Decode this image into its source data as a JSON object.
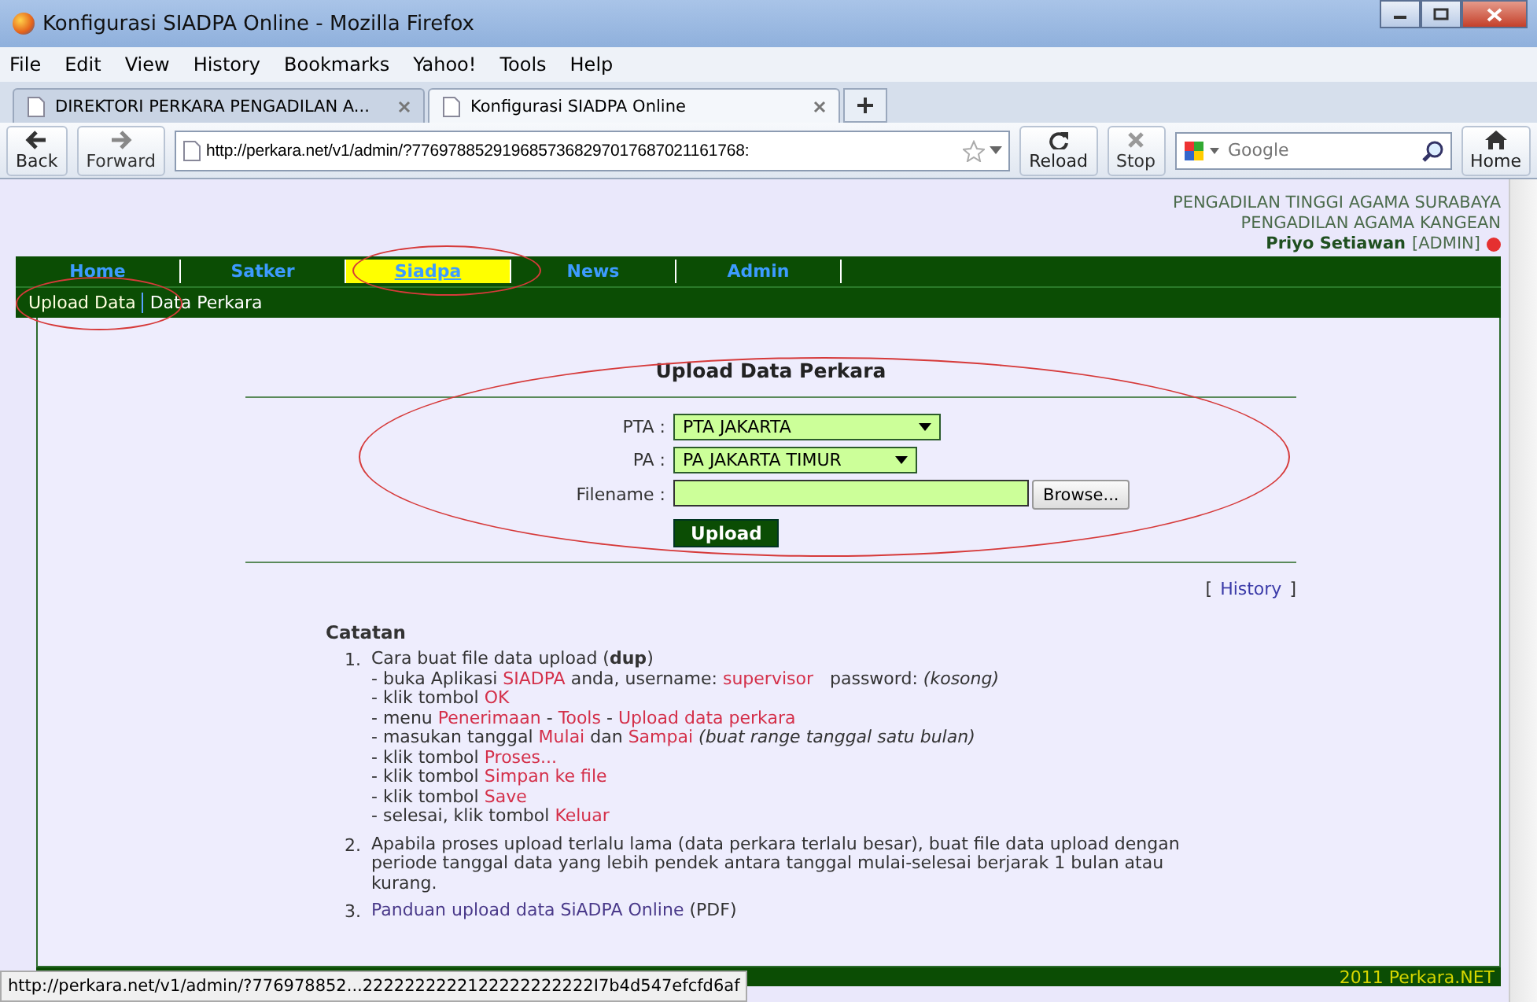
{
  "window": {
    "title": "Konfigurasi SIADPA Online - Mozilla Firefox"
  },
  "menu": [
    "File",
    "Edit",
    "View",
    "History",
    "Bookmarks",
    "Yahoo!",
    "Tools",
    "Help"
  ],
  "tabs": [
    {
      "label": "DIREKTORI PERKARA PENGADILAN A...",
      "selected": false
    },
    {
      "label": "Konfigurasi SIADPA Online",
      "selected": true
    }
  ],
  "toolbar": {
    "back": "Back",
    "forward": "Forward",
    "address": "http://perkara.net/v1/admin/?7769788529196857368297017687021161768:",
    "reload": "Reload",
    "stop": "Stop",
    "search_placeholder": "Google",
    "home": "Home"
  },
  "header": {
    "lines": [
      "PENGADILAN TINGGI AGAMA SURABAYA",
      "PENGADILAN AGAMA KANGEAN"
    ],
    "user": "Priyo Setiawan",
    "role": "[ADMIN]"
  },
  "nav": [
    {
      "label": "Home",
      "selected": false
    },
    {
      "label": "Satker",
      "selected": false
    },
    {
      "label": "Siadpa",
      "selected": true
    },
    {
      "label": "News",
      "selected": false
    },
    {
      "label": "Admin",
      "selected": false
    }
  ],
  "subnav": [
    {
      "label": "Upload Data",
      "selected": true
    },
    {
      "label": "Data Perkara",
      "selected": false
    }
  ],
  "form": {
    "title": "Upload Data Perkara",
    "fields": [
      {
        "kind": "select",
        "label": "PTA :",
        "value": "PTA JAKARTA"
      },
      {
        "kind": "select",
        "label": "PA :",
        "value": "PA JAKARTA TIMUR"
      },
      {
        "kind": "file",
        "label": "Filename :",
        "button": "Browse..."
      }
    ],
    "submit": "Upload"
  },
  "history": {
    "open": "[",
    "label": "History",
    "close": "]"
  },
  "notes": {
    "title": "Catatan",
    "items": [
      {
        "number": "1.",
        "lines": [
          [
            {
              "kind": "text",
              "text": "Cara buat file data upload (**dup**)"
            }
          ],
          [
            {
              "kind": "text",
              "text": "- buka Aplikasi "
            },
            {
              "kind": "red",
              "text": "SIADPA"
            },
            {
              "kind": "text",
              "text": " anda, username: "
            },
            {
              "kind": "red",
              "text": "supervisor"
            },
            {
              "kind": "text",
              "text": "   password: "
            },
            {
              "kind": "italic",
              "text": "(kosong)"
            }
          ],
          [
            {
              "kind": "text",
              "text": "- klik tombol "
            },
            {
              "kind": "red",
              "text": "OK"
            }
          ],
          [
            {
              "kind": "text",
              "text": "- menu "
            },
            {
              "kind": "red",
              "text": "Penerimaan"
            },
            {
              "kind": "text",
              "text": " - "
            },
            {
              "kind": "red",
              "text": "Tools"
            },
            {
              "kind": "text",
              "text": " - "
            },
            {
              "kind": "red",
              "text": "Upload data perkara"
            }
          ],
          [
            {
              "kind": "text",
              "text": "- masukan tanggal "
            },
            {
              "kind": "red",
              "text": "Mulai"
            },
            {
              "kind": "text",
              "text": " dan "
            },
            {
              "kind": "red",
              "text": "Sampai"
            },
            {
              "kind": "italic",
              "text": " (buat range tanggal satu bulan)"
            }
          ],
          [
            {
              "kind": "text",
              "text": "- klik tombol "
            },
            {
              "kind": "red",
              "text": "Proses..."
            }
          ],
          [
            {
              "kind": "text",
              "text": "- klik tombol "
            },
            {
              "kind": "red",
              "text": "Simpan ke file"
            }
          ],
          [
            {
              "kind": "text",
              "text": "- klik tombol "
            },
            {
              "kind": "red",
              "text": "Save"
            }
          ],
          [
            {
              "kind": "text",
              "text": "- selesai, klik tombol "
            },
            {
              "kind": "red",
              "text": "Keluar"
            }
          ]
        ]
      },
      {
        "number": "2.",
        "lines": [
          [
            {
              "kind": "text",
              "text": "Apabila proses upload terlalu lama (data perkara terlalu besar), buat file data upload dengan periode tanggal data yang lebih pendek antara tanggal mulai-selesai berjarak 1 bulan atau kurang."
            }
          ]
        ]
      },
      {
        "number": "3.",
        "lines": [
          [
            {
              "kind": "link",
              "text": "Panduan upload data SiADPA Online"
            },
            {
              "kind": "text",
              "text": " (PDF)"
            }
          ]
        ]
      }
    ]
  },
  "footer": "2011 Perkara.NET",
  "status_bar": {
    "url": "http://perkara.net/v1/admin/?776978852...2222222222122222222222I7b4d547efcfd6af"
  }
}
